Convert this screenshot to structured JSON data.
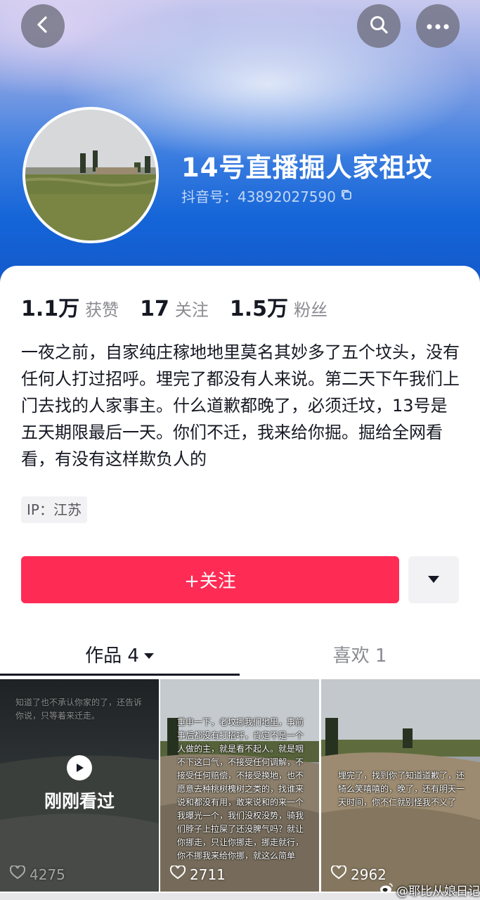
{
  "header": {
    "nickname": "14号直播掘人家祖坟",
    "douyin_id": "抖音号：43892027590"
  },
  "stats": [
    {
      "value": "1.1万",
      "label": "获赞"
    },
    {
      "value": "17",
      "label": "关注"
    },
    {
      "value": "1.5万",
      "label": "粉丝"
    }
  ],
  "bio": "一夜之前，自家纯庄稼地地里莫名其妙多了五个坟头，没有任何人打过招呼。埋完了都没有人来说。第二天下午我们上门去找的人家事主。什么道歉都晚了，必须迁坟，13号是五天期限最后一天。你们不迁，我来给你掘。掘给全网看看，有没有这样欺负人的",
  "ip": "IP：江苏",
  "actions": {
    "follow_label": "+关注"
  },
  "tabs": {
    "works": "作品 4",
    "likes": "喜欢 1"
  },
  "videos": [
    {
      "overlay_text": "知道了也不承认你家的了，还告诉你说，只等着来迁走。",
      "badge": "刚刚看过",
      "likes": "4275"
    },
    {
      "overlay_text": "重申一下，老坟挪我们地里，事前事后都没有打招呼，肯定不是一个人做的主，就是看不起人。就是咽不下这口气，不接受任何调解，不接受任何赔偿，不接受换地，也不愿意去种桃树槐树之类的，找谁来说和都没有用，敢来说和的来一个我曝光一个，我们没权没势，骑我们脖子上拉屎了还没脾气吗？就让你挪走，只让你挪走，挪走就行，你不挪我来给你挪，就这么简单",
      "likes": "2711"
    },
    {
      "overlay_text": "埋完了，找到你了知道道歉了，还犄么笑嘻嘻的，晚了，还有明天一天时间，你不仁就别怪我不义了",
      "likes": "2962"
    }
  ],
  "watermark": "@耶比从娘日记",
  "colors": {
    "follow": "#fe2c55",
    "banner": "#1565d8",
    "text_primary": "#161823",
    "text_secondary": "#8a8b91"
  }
}
